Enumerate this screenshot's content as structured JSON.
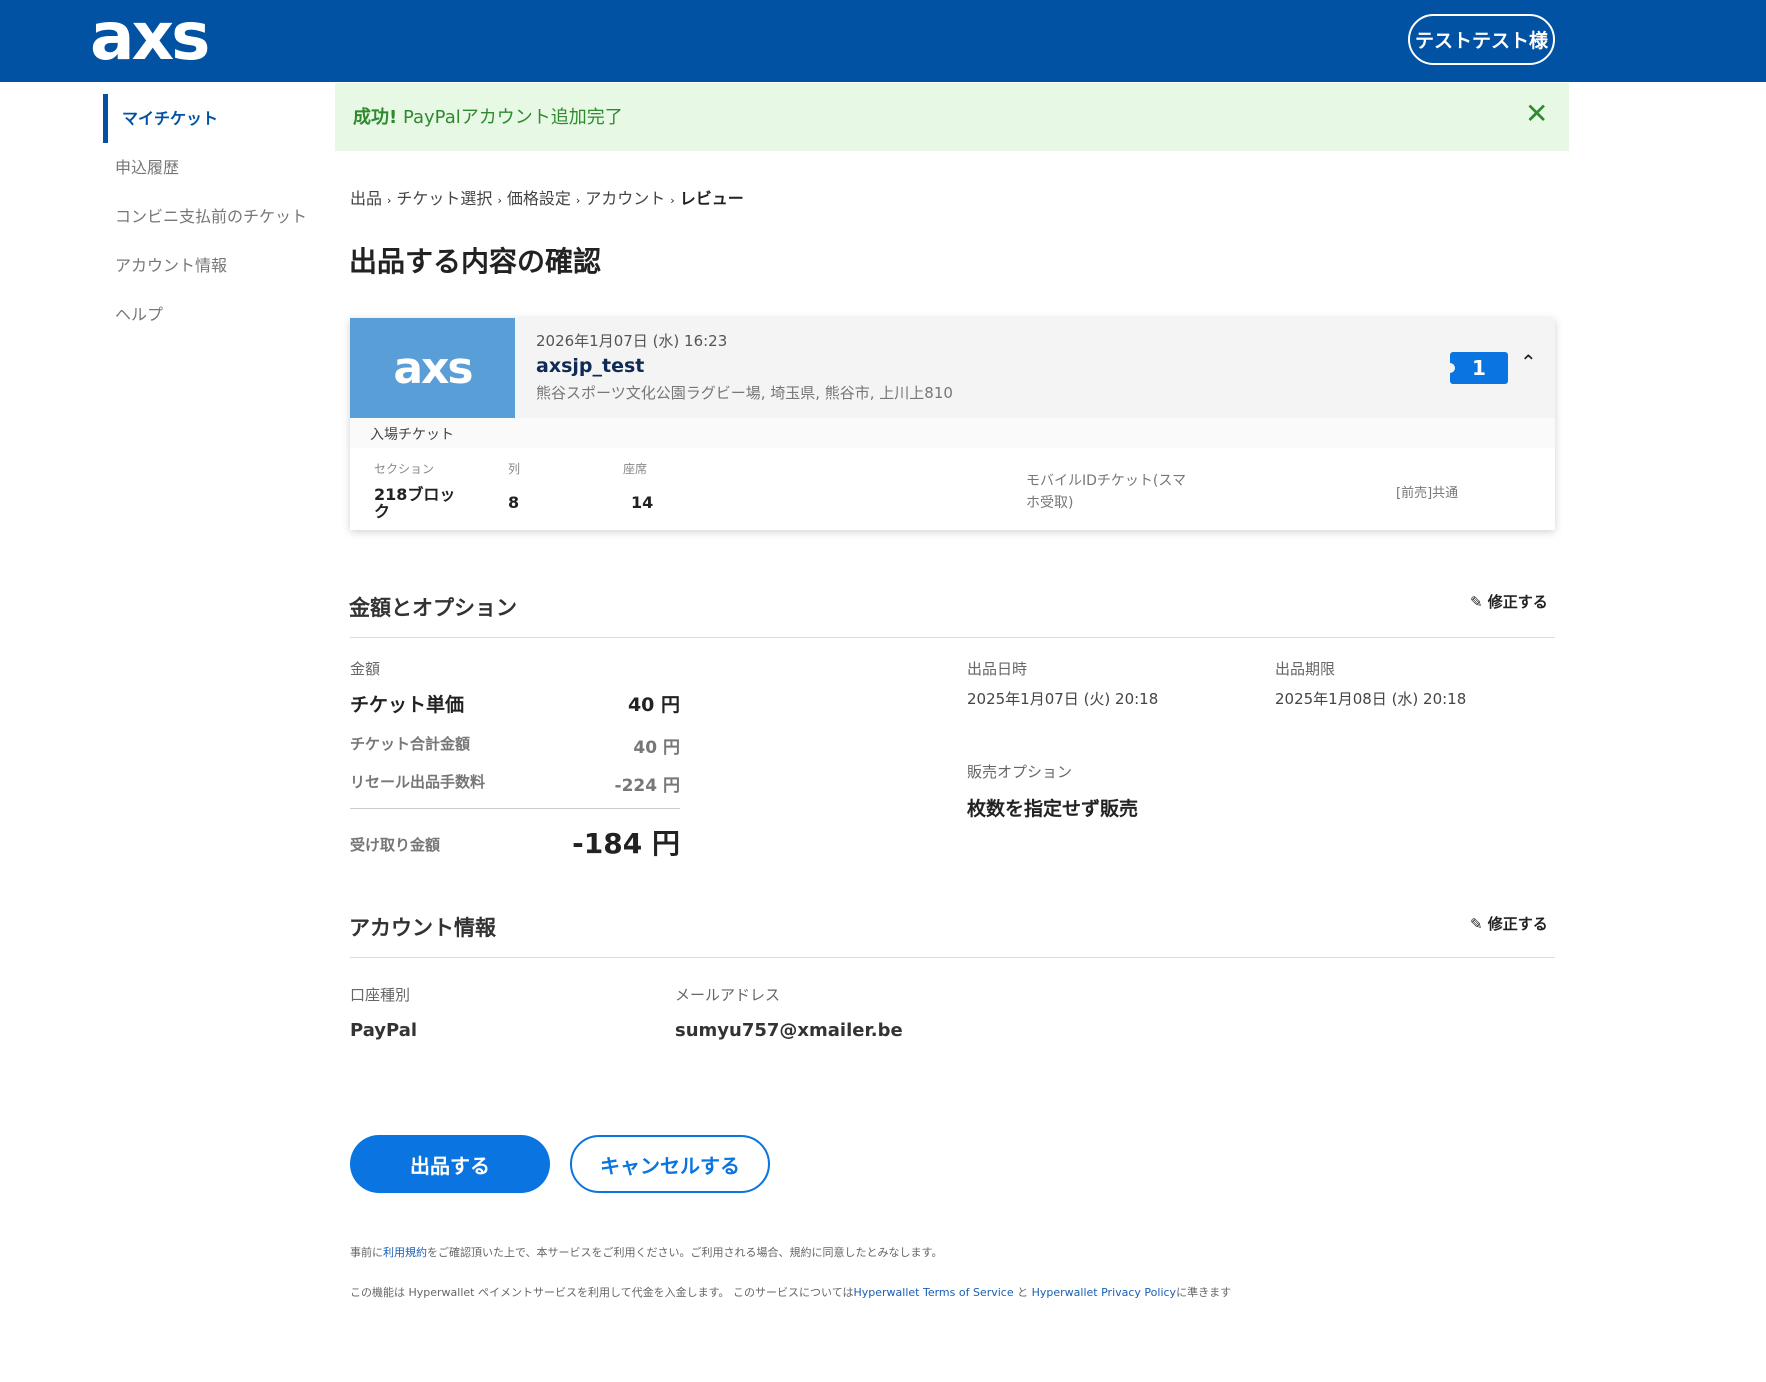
{
  "header": {
    "logo": "axs",
    "user_button": "テストテスト様"
  },
  "sidebar": {
    "items": [
      {
        "label": "マイチケット"
      },
      {
        "label": "申込履歴"
      },
      {
        "label": "コンビニ支払前のチケット"
      },
      {
        "label": "アカウント情報"
      },
      {
        "label": "ヘルプ"
      }
    ]
  },
  "banner": {
    "strong": "成功!",
    "message": " PayPalアカウント追加完了",
    "close": "✕"
  },
  "breadcrumb": {
    "items": [
      "出品",
      "チケット選択",
      "価格設定",
      "アカウント"
    ],
    "current": "レビュー",
    "separator": "›"
  },
  "page_title": "出品する内容の確認",
  "event": {
    "logo": "axs",
    "date": "2026年1月07日 (水) 16:23",
    "name": "axsjp_test",
    "venue": "熊谷スポーツ文化公園ラグビー場, 埼玉県, 熊谷市, 上川上810",
    "quantity": "1",
    "chevron": "⌃",
    "ticket_type": "入場チケット",
    "section_label": "セクション",
    "section_value": "218ブロック",
    "row_label": "列",
    "row_value": "8",
    "seat_label": "座席",
    "seat_value": "14",
    "delivery": "モバイルIDチケット(スマホ受取)",
    "presale": "[前売]共通"
  },
  "pricing": {
    "title": "金額とオプション",
    "edit": "修正する",
    "amount_label": "金額",
    "unit_price_label": "チケット単価",
    "unit_price_value": "40 円",
    "total_label": "チケット合計金額",
    "total_value": "40 円",
    "fee_label": "リセール出品手数料",
    "fee_value": "-224 円",
    "receive_label": "受け取り金額",
    "receive_value": "-184 円",
    "listing_date_label": "出品日時",
    "listing_date_value": "2025年1月07日 (火) 20:18",
    "deadline_label": "出品期限",
    "deadline_value": "2025年1月08日 (水) 20:18",
    "option_label": "販売オプション",
    "option_value": "枚数を指定せず販売"
  },
  "account": {
    "title": "アカウント情報",
    "edit": "修正する",
    "type_label": "口座種別",
    "type_value": "PayPal",
    "email_label": "メールアドレス",
    "email_value": "sumyu757@xmailer.be"
  },
  "buttons": {
    "submit": "出品する",
    "cancel": "キャンセルする"
  },
  "footer": {
    "line1_pre": "事前に",
    "line1_link": "利用規約",
    "line1_post": "をご確認頂いた上で、本サービスをご利用ください。ご利用される場合、規約に同意したとみなします。",
    "line2_pre": "この機能は Hyperwallet ペイメントサービスを利用して代金を入金します。 このサービスについては",
    "line2_link1": "Hyperwallet Terms of Service",
    "line2_mid": " と ",
    "line2_link2": "Hyperwallet Privacy Policy",
    "line2_post": "に準きます"
  }
}
